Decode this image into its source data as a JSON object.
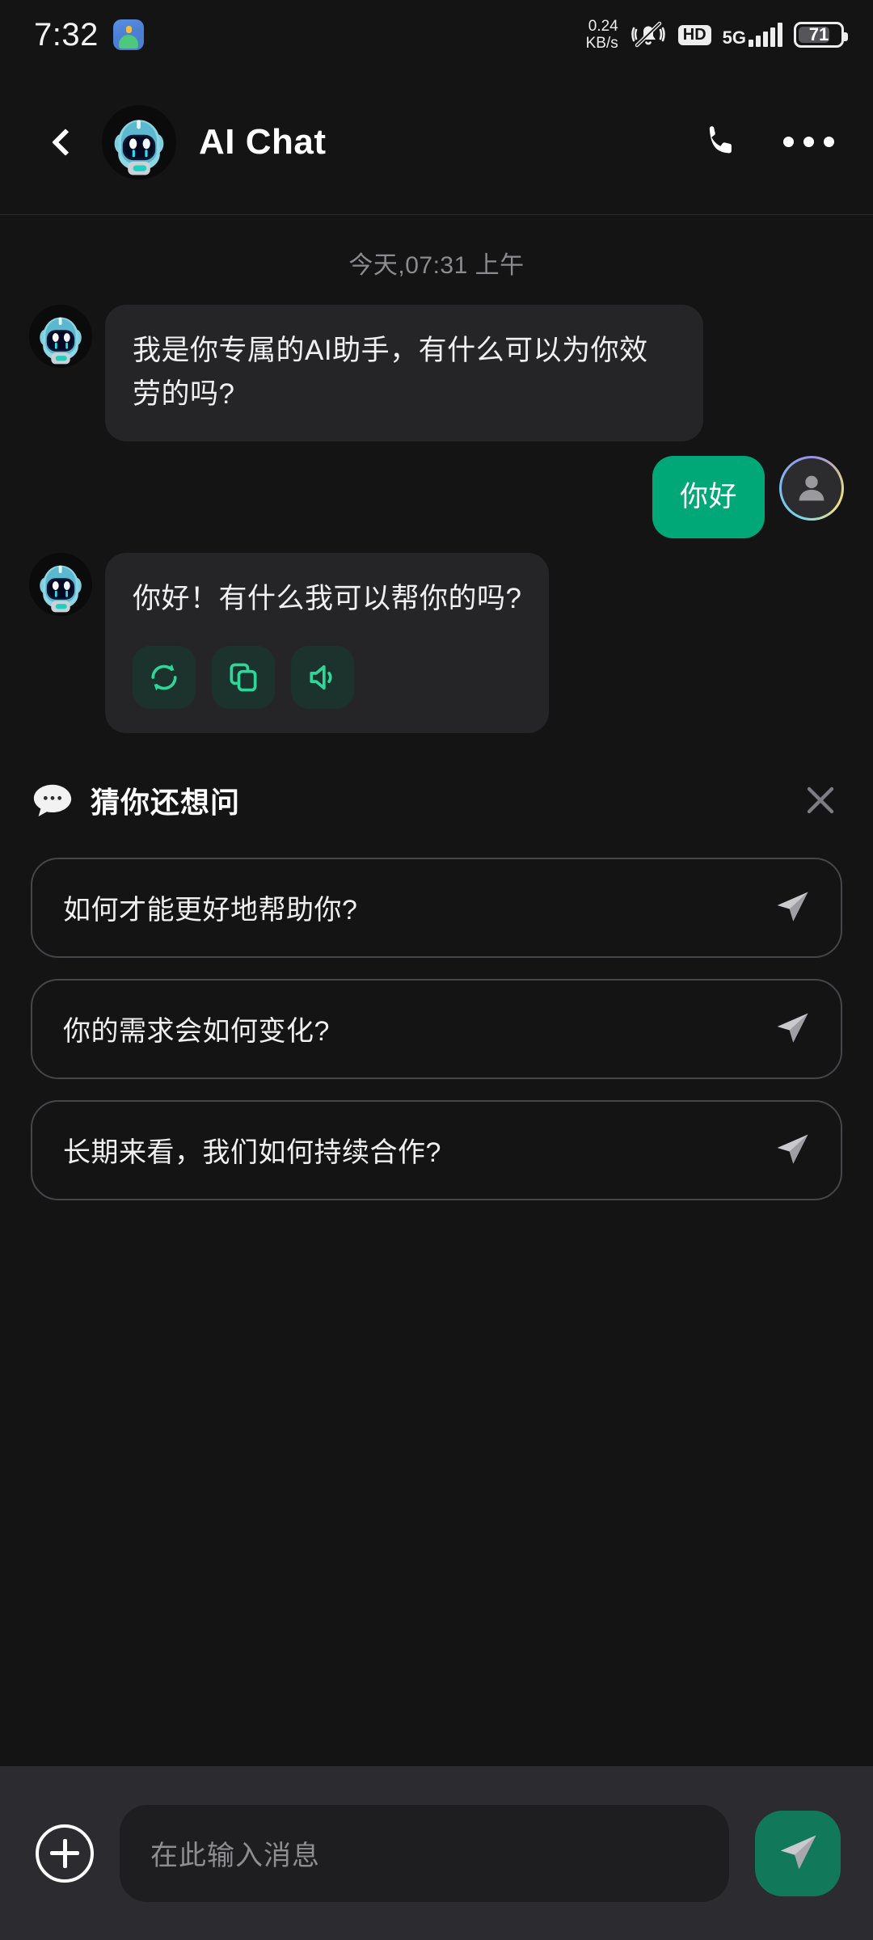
{
  "status_bar": {
    "time": "7:32",
    "app_icon": "android-app-icon",
    "network_speed_value": "0.24",
    "network_speed_unit": "KB/s",
    "mute_icon": "bell-muted-icon",
    "hd_label": "HD",
    "network_type": "5G",
    "signal_bars": 5,
    "battery_percent": "71"
  },
  "header": {
    "back_icon": "chevron-left-icon",
    "avatar_icon": "robot-avatar",
    "title": "AI Chat",
    "call_icon": "phone-icon",
    "more_icon": "more-options-icon"
  },
  "chat": {
    "daystamp": "今天,07:31 上午",
    "messages": [
      {
        "role": "bot",
        "text": "我是你专属的AI助手，有什么可以为你效劳的吗?",
        "avatar": "robot-avatar"
      },
      {
        "role": "user",
        "text": "你好",
        "avatar": "user-avatar"
      },
      {
        "role": "bot",
        "text": "你好！有什么我可以帮你的吗?",
        "avatar": "robot-avatar",
        "actions": [
          {
            "name": "regenerate-button",
            "icon": "refresh-icon"
          },
          {
            "name": "copy-button",
            "icon": "copy-icon"
          },
          {
            "name": "speak-button",
            "icon": "speaker-icon"
          }
        ]
      }
    ]
  },
  "suggestions": {
    "icon": "chat-bubble-icon",
    "title": "猜你还想问",
    "close_icon": "close-icon",
    "items": [
      {
        "text": "如何才能更好地帮助你?",
        "send_icon": "send-icon"
      },
      {
        "text": "你的需求会如何变化?",
        "send_icon": "send-icon"
      },
      {
        "text": "长期来看，我们如何持续合作?",
        "send_icon": "send-icon"
      }
    ]
  },
  "input_bar": {
    "add_icon": "plus-icon",
    "placeholder": "在此输入消息",
    "value": "",
    "send_icon": "send-icon"
  },
  "colors": {
    "background": "#141415",
    "bot_bubble": "#252527",
    "user_bubble": "#00a878",
    "accent_green": "#2dd699",
    "send_button": "#11795a",
    "input_bar": "#2b2b30"
  }
}
